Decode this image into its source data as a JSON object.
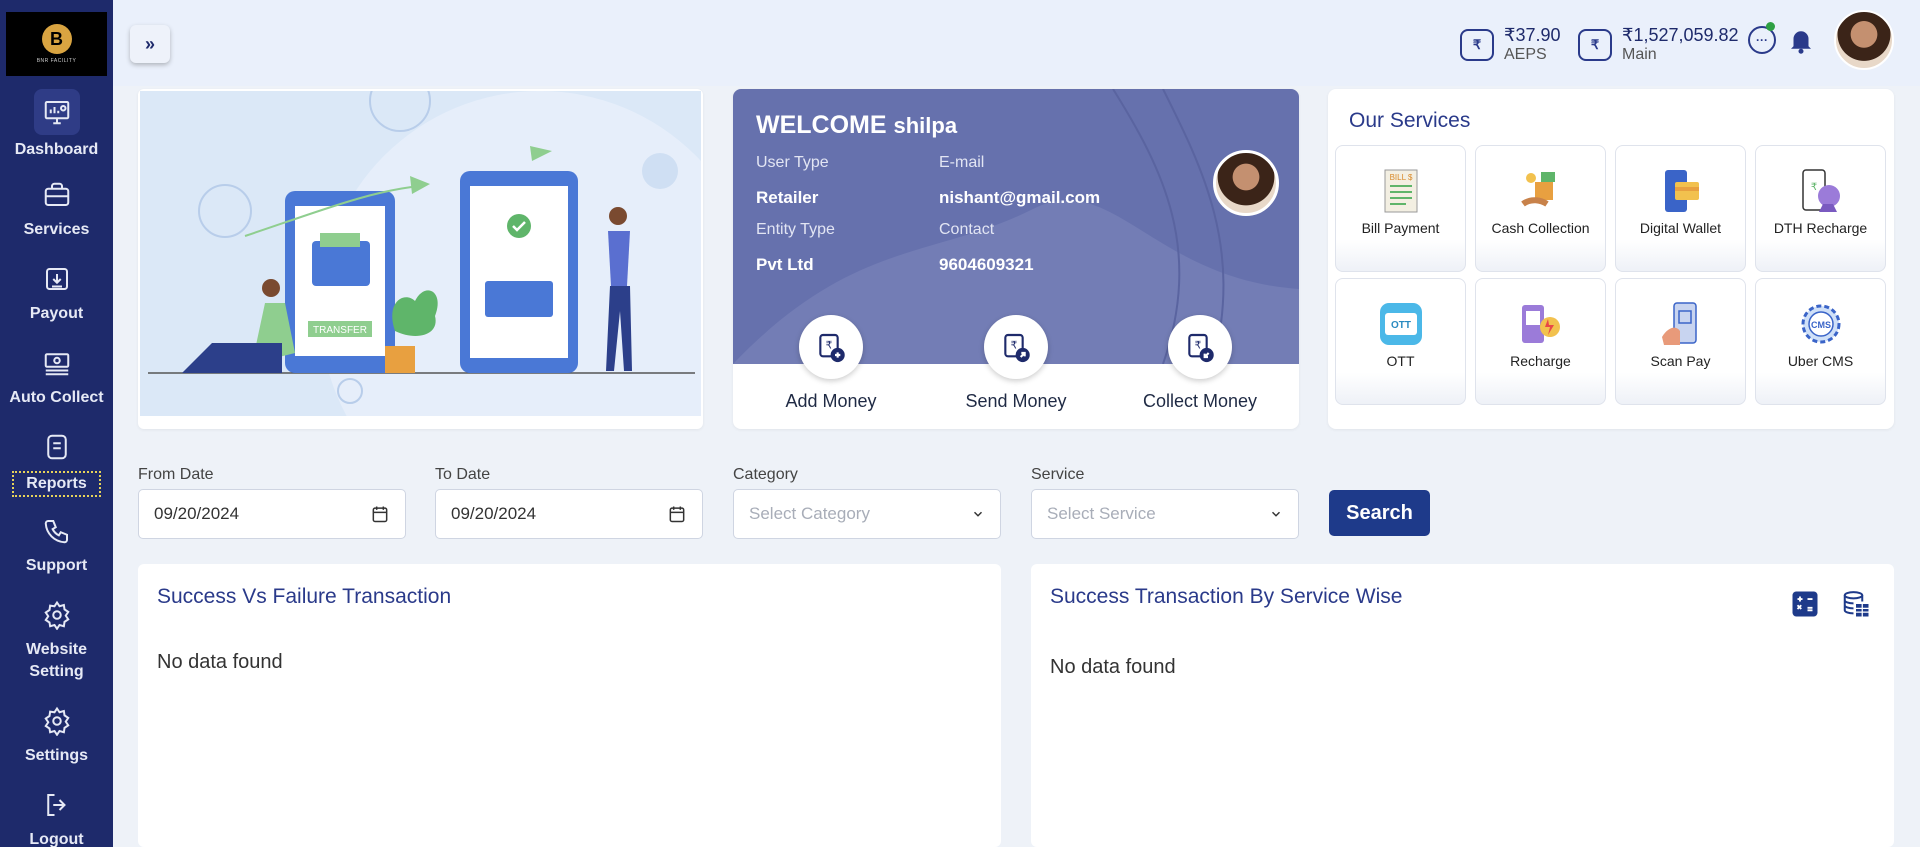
{
  "brand": {
    "logo_text": "BNR FACILITY"
  },
  "sidebar": {
    "items": [
      {
        "label": "Dashboard",
        "icon": "dashboard-icon"
      },
      {
        "label": "Services",
        "icon": "briefcase-icon"
      },
      {
        "label": "Payout",
        "icon": "payout-icon"
      },
      {
        "label": "Auto Collect",
        "icon": "auto-collect-icon"
      },
      {
        "label": "Reports",
        "icon": "reports-icon"
      },
      {
        "label": "Support",
        "icon": "phone-icon"
      },
      {
        "label": "Website Setting",
        "icon": "gear-icon"
      },
      {
        "label": "Settings",
        "icon": "gear-icon"
      },
      {
        "label": "Logout",
        "icon": "logout-icon"
      }
    ]
  },
  "topbar": {
    "toggle": "»",
    "wallets": [
      {
        "amount": "₹37.90",
        "name": "AEPS"
      },
      {
        "amount": "₹1,527,059.82",
        "name": "Main"
      }
    ]
  },
  "welcome": {
    "title": "WELCOME",
    "user": "shilpa",
    "user_type_label": "User Type",
    "user_type": "Retailer",
    "email_label": "E-mail",
    "email": "nishant@gmail.com",
    "entity_type_label": "Entity Type",
    "entity_type": "Pvt Ltd",
    "contact_label": "Contact",
    "contact": "9604609321",
    "actions": [
      "Add Money",
      "Send Money",
      "Collect Money"
    ]
  },
  "banner": {
    "badge": "TRANSFER"
  },
  "services": {
    "title": "Our Services",
    "items": [
      {
        "label": "Bill Payment",
        "icon": "bill-icon"
      },
      {
        "label": "Cash Collection",
        "icon": "cash-icon"
      },
      {
        "label": "Digital Wallet",
        "icon": "wallet-icon"
      },
      {
        "label": "DTH Recharge",
        "icon": "dth-icon"
      },
      {
        "label": "OTT",
        "icon": "ott-icon"
      },
      {
        "label": "Recharge",
        "icon": "recharge-icon"
      },
      {
        "label": "Scan Pay",
        "icon": "scan-pay-icon"
      },
      {
        "label": "Uber CMS",
        "icon": "cms-icon"
      }
    ]
  },
  "filters": {
    "from_label": "From Date",
    "from_value": "09/20/2024",
    "to_label": "To Date",
    "to_value": "09/20/2024",
    "category_label": "Category",
    "category_placeholder": "Select Category",
    "service_label": "Service",
    "service_placeholder": "Select Service",
    "search_label": "Search"
  },
  "panels": {
    "left_title": "Success Vs Failure Transaction",
    "left_empty": "No data found",
    "right_title": "Success Transaction By Service Wise",
    "right_empty": "No data found"
  },
  "colors": {
    "sidebar": "#1e2a6b",
    "accent": "#2a3a8a",
    "welcome": "#6671ad",
    "button": "#1e3a8a"
  }
}
